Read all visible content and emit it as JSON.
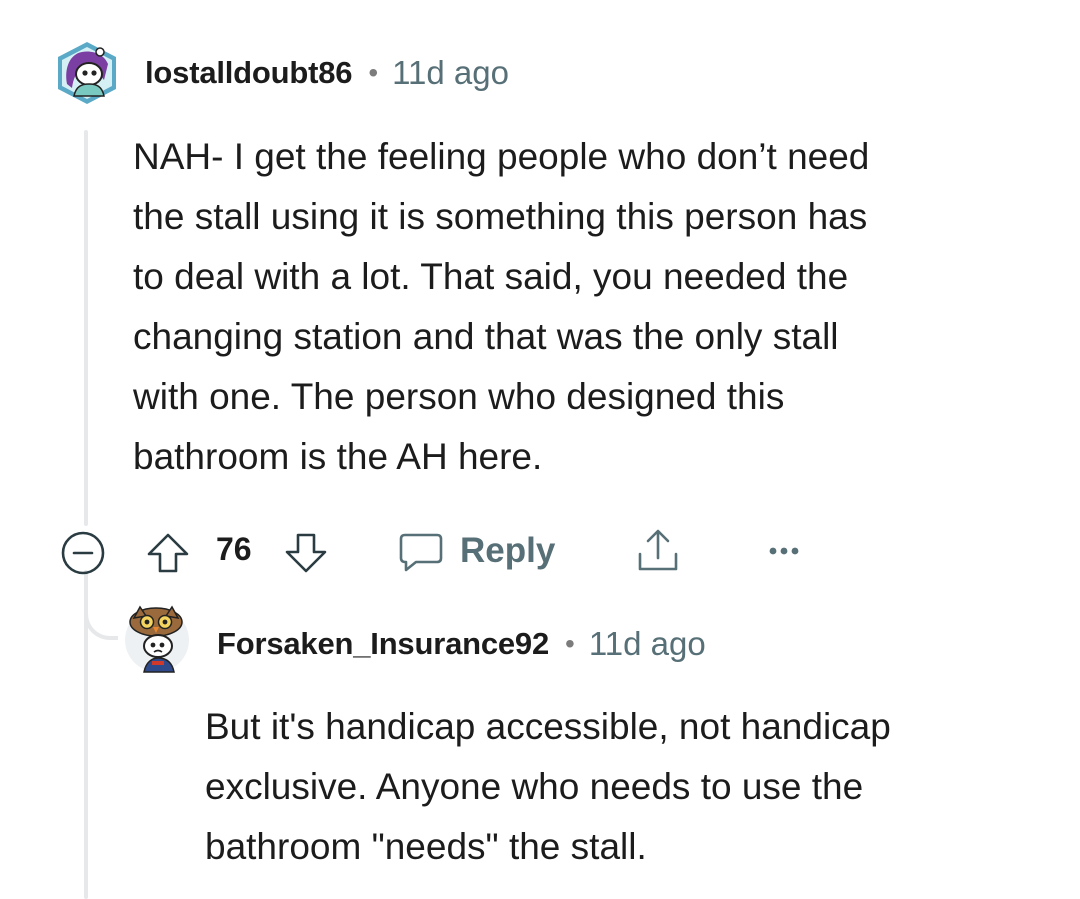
{
  "comments": [
    {
      "username": "lostalldoubt86",
      "separator": "•",
      "time": "11d ago",
      "body_lines": [
        "NAH- I get the feeling people who don’t need",
        "the stall using it is something this person has",
        "to deal with a lot. That said, you needed the",
        "changing station and that was the only stall",
        "with one. The person who designed this",
        "bathroom is the AH here."
      ],
      "avatar_icon": "snoo-avatar-purple-hair",
      "actions": {
        "collapse_icon": "minus-circle-icon",
        "upvote_icon": "arrow-up-icon",
        "score": "76",
        "downvote_icon": "arrow-down-icon",
        "reply_icon": "chat-bubble-icon",
        "reply_label": "Reply",
        "share_icon": "share-icon",
        "more_icon": "ellipsis-icon"
      }
    },
    {
      "username": "Forsaken_Insurance92",
      "separator": "•",
      "time": "11d ago",
      "body_lines": [
        "But it's handicap accessible, not handicap",
        "exclusive. Anyone who needs to use the",
        "bathroom \"needs\" the stall."
      ],
      "avatar_icon": "snoo-avatar-owl-hat"
    }
  ],
  "colors": {
    "text": "#1c1c1c",
    "meta": "#576f76",
    "icon": "#2a3c42",
    "thread_line": "#e6e8ea"
  }
}
